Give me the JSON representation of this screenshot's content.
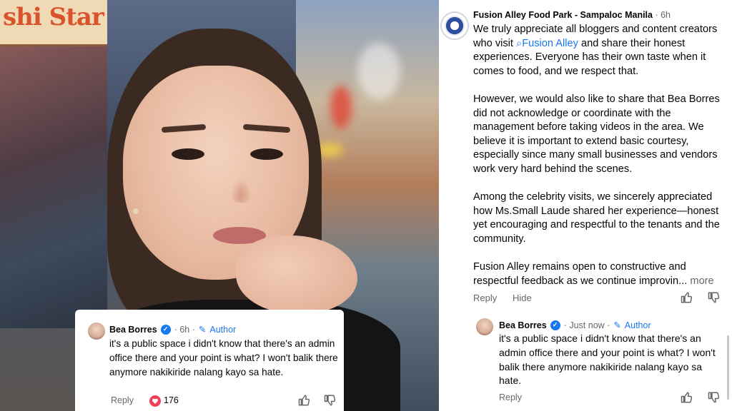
{
  "photo": {
    "shop_sign_text": "shi Star"
  },
  "left_comment": {
    "author": "Bea Borres",
    "time": "· 6h ·",
    "author_tag": "Author",
    "text": "it's a public space i didn't know that there's an admin office there and your point is what? I won't balik there anymore nakikiride nalang kayo sa hate.",
    "reply_label": "Reply",
    "reaction_count": "176"
  },
  "post": {
    "page_name": "Fusion Alley Food Park - Sampaloc Manila",
    "time": "· 6h",
    "p1_a": "We truly appreciate all bloggers and content creators who visit",
    "p1_link": "Fusion Alley",
    "p1_b": "and share their honest experiences. Everyone has their own taste when it comes to food, and we respect that.",
    "p2": "However, we would also like to share that Bea Borres did not acknowledge or coordinate with the management before taking videos in the area. We believe it is important to extend basic courtesy, especially since many small businesses and vendors work very hard behind the scenes.",
    "p3": "Among the celebrity visits, we sincerely appreciated how Ms.Small Laude shared her experience—honest yet encouraging and respectful to the tenants and the community.",
    "p4": "Fusion Alley remains open to constructive and respectful feedback as we continue improvin...",
    "more_label": "more",
    "reply_label": "Reply",
    "hide_label": "Hide"
  },
  "right_comment": {
    "author": "Bea Borres",
    "time": "· Just now ·",
    "author_tag": "Author",
    "text": "it's a public space i didn't know that there's an admin office there and your point is what? I won't balik there anymore nakikiride nalang kayo sa hate.",
    "reply_label": "Reply"
  },
  "colors": {
    "facebook_blue": "#1877f2",
    "meta_gray": "#65676b",
    "like_red": "#f33e58"
  },
  "icons": [
    "verified-badge-icon",
    "author-pencil-icon",
    "heart-reaction-icon",
    "thumbs-up-icon",
    "thumbs-down-icon",
    "search-link-icon"
  ]
}
